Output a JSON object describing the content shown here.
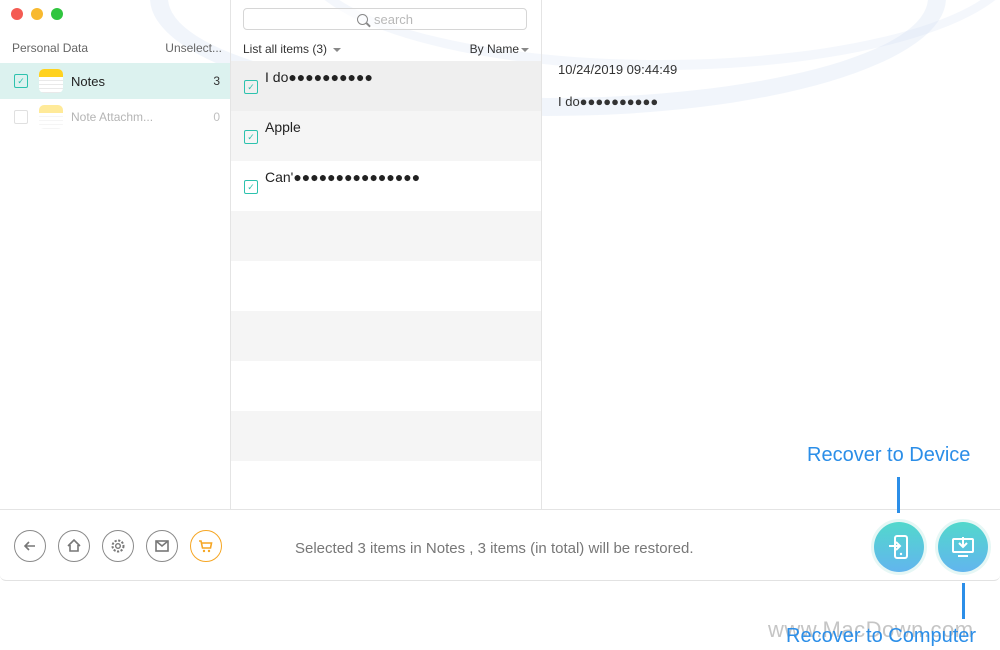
{
  "sidebar": {
    "header_left": "Personal Data",
    "header_right": "Unselect...",
    "items": [
      {
        "label": "Notes",
        "count": "3",
        "checked": true
      },
      {
        "label": "Note Attachm...",
        "count": "0",
        "checked": false
      }
    ]
  },
  "list": {
    "search_placeholder": "search",
    "filter_label": "List all items (3)",
    "sort_label": "By Name",
    "items": [
      {
        "title": "I do●●●●●●●●●●",
        "checked": true
      },
      {
        "title": "Apple",
        "checked": true
      },
      {
        "title": "Can'●●●●●●●●●●●●●●●",
        "checked": true
      }
    ]
  },
  "detail": {
    "date": "10/24/2019 09:44:49",
    "body": "I do●●●●●●●●●●"
  },
  "footer": {
    "status": "Selected 3 items in Notes , 3 items (in total) will be restored.",
    "nav_icons": [
      "back-icon",
      "home-icon",
      "settings-icon",
      "mail-icon",
      "cart-icon"
    ]
  },
  "annotations": {
    "recover_device": "Recover to Device",
    "recover_computer": "Recover to Computer",
    "watermark": "www.MacDown.com"
  },
  "colors": {
    "accent": "#2dc2ae",
    "annotation": "#2b8ee8",
    "cart": "#f6a623"
  }
}
